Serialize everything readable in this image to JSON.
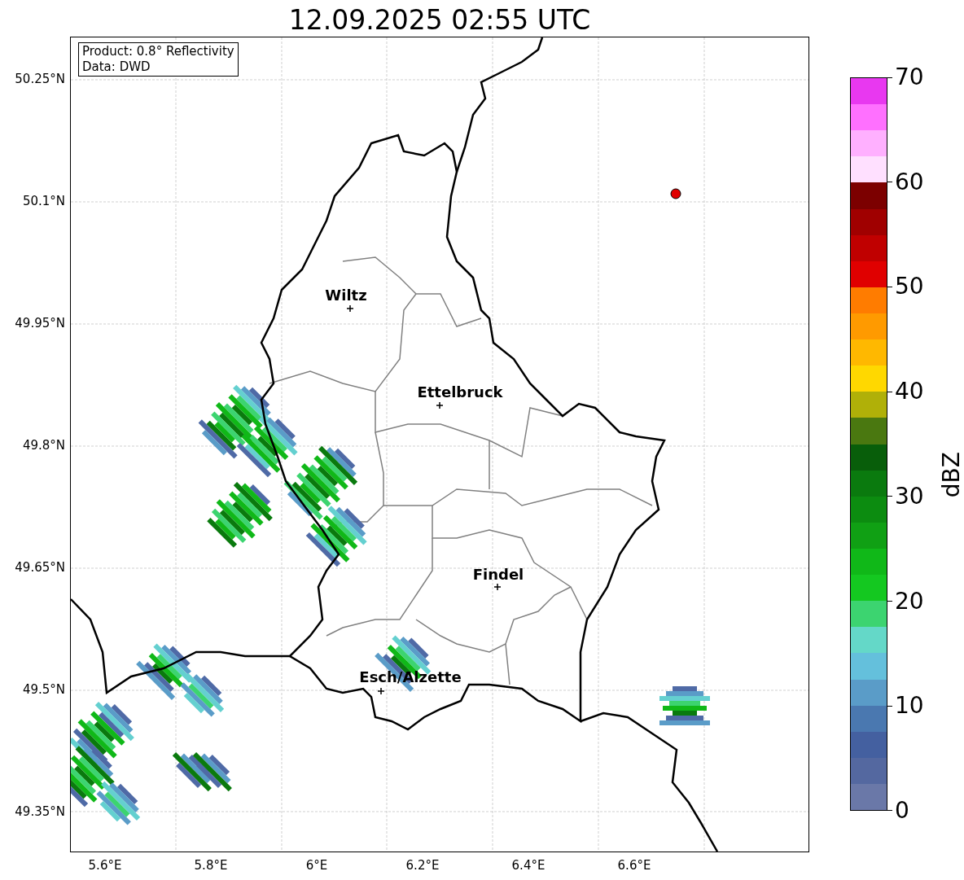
{
  "title": "12.09.2025 02:55 UTC",
  "map": {
    "info_box": [
      "Product: 0.8° Reflectivity",
      "Data: DWD"
    ],
    "lat_labels": [
      "50.25°N",
      "50.1°N",
      "49.95°N",
      "49.8°N",
      "49.65°N",
      "49.5°N",
      "49.35°N"
    ],
    "lon_labels": [
      "5.6°E",
      "5.8°E",
      "6°E",
      "6.2°E",
      "6.4°E",
      "6.6°E"
    ],
    "cities": [
      {
        "name": "Wiltz"
      },
      {
        "name": "Ettelbruck"
      },
      {
        "name": "Findel"
      },
      {
        "name": "Esch/Alzette"
      }
    ]
  },
  "colorbar": {
    "label": "dBZ",
    "ticks": [
      "70",
      "60",
      "50",
      "40",
      "30",
      "20",
      "10",
      "0"
    ],
    "segments": [
      {
        "color": "#e838f0"
      },
      {
        "color": "#ff70ff"
      },
      {
        "color": "#ffb0ff"
      },
      {
        "color": "#ffe0ff"
      },
      {
        "color": "#7c0000"
      },
      {
        "color": "#a00000"
      },
      {
        "color": "#c00000"
      },
      {
        "color": "#e00000"
      },
      {
        "color": "#ff7c00"
      },
      {
        "color": "#ff9a00"
      },
      {
        "color": "#ffb800"
      },
      {
        "color": "#ffd800"
      },
      {
        "color": "#b0b008"
      },
      {
        "color": "#4a7810"
      },
      {
        "color": "#085e0a"
      },
      {
        "color": "#0a7a0e"
      },
      {
        "color": "#0c8c10"
      },
      {
        "color": "#10a014"
      },
      {
        "color": "#10b818"
      },
      {
        "color": "#14c820"
      },
      {
        "color": "#3cd470"
      },
      {
        "color": "#64d8c8"
      },
      {
        "color": "#64c0dc"
      },
      {
        "color": "#5a9cc8"
      },
      {
        "color": "#4a78b0"
      },
      {
        "color": "#4460a0"
      },
      {
        "color": "#5468a0"
      },
      {
        "color": "#6a78a8"
      }
    ]
  }
}
